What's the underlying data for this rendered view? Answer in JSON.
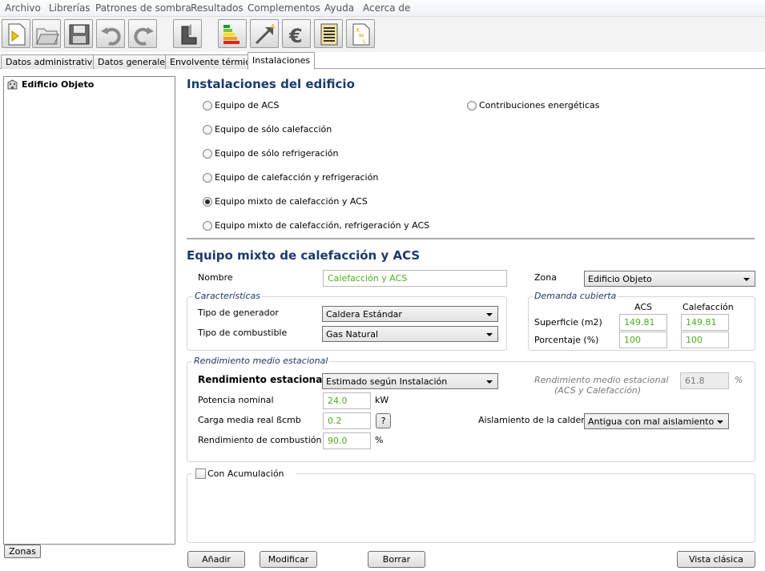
{
  "menu": [
    "Archivo",
    "Librerías",
    "Patrones de sombra",
    "Resultados",
    "Complementos",
    "Ayuda",
    "Acerca de"
  ],
  "tabs": [
    "Datos administrativos",
    "Datos generales",
    "Envolvente térmica",
    "Instalaciones"
  ],
  "tree": {
    "root": "Edificio Objeto"
  },
  "zonas_button": "Zonas",
  "instalaciones": {
    "title": "Instalaciones del edificio",
    "options": [
      "Equipo de ACS",
      "Equipo de sólo calefacción",
      "Equipo de sólo refrigeración",
      "Equipo de calefacción y refrigeración",
      "Equipo mixto de calefacción y ACS",
      "Equipo mixto de calefacción, refrigeración y ACS"
    ],
    "selected": "Equipo mixto de calefacción y ACS",
    "contrib": "Contribuciones energéticas"
  },
  "equipo": {
    "title": "Equipo mixto de calefacción y ACS",
    "nombre_label": "Nombre",
    "nombre_value": "Calefacción y ACS",
    "zona_label": "Zona",
    "zona_value": "Edificio Objeto"
  },
  "caracteristicas": {
    "legend": "Características",
    "tipo_generador_label": "Tipo de generador",
    "tipo_generador_value": "Caldera Estándar",
    "tipo_combustible_label": "Tipo de combustible",
    "tipo_combustible_value": "Gas Natural"
  },
  "demanda": {
    "legend": "Demanda cubierta",
    "col_acs": "ACS",
    "col_calef": "Calefacción",
    "superficie_label": "Superficie (m2)",
    "superficie_acs": "149.81",
    "superficie_calef": "149.81",
    "porcentaje_label": "Porcentaje (%)",
    "porcentaje_acs": "100",
    "porcentaje_calef": "100"
  },
  "rendimiento": {
    "legend": "Rendimiento medio estacional",
    "estacional_label": "Rendimiento estacional",
    "estacional_value": "Estimado según Instalación",
    "medio_label_1": "Rendimiento medio estacional",
    "medio_label_2": "(ACS y Calefacción)",
    "medio_value": "61.8",
    "medio_unit": "%",
    "potencia_label": "Potencia nominal",
    "potencia_value": "24.0",
    "potencia_unit": "kW",
    "carga_label": "Carga media real ßcmb",
    "carga_value": "0.2",
    "help_label": "?",
    "aislamiento_label": "Aislamiento de la caldera",
    "aislamiento_value": "Antigua con mal aislamiento",
    "combustion_label": "Rendimiento de combustión",
    "combustion_value": "90.0",
    "combustion_unit": "%"
  },
  "acumulacion": {
    "label": "Con Acumulación"
  },
  "buttons": {
    "anadir": "Añadir",
    "modificar": "Modificar",
    "borrar": "Borrar",
    "vista": "Vista clásica"
  }
}
